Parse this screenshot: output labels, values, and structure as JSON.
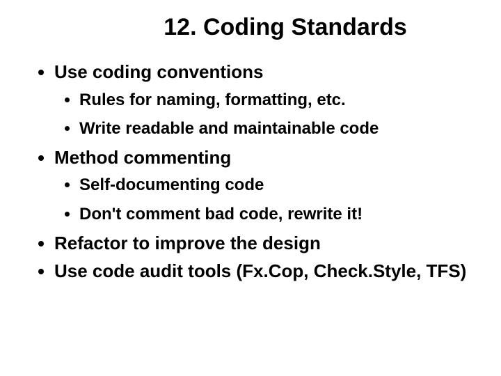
{
  "slide": {
    "title": "12. Coding Standards",
    "bullets": [
      {
        "text": "Use coding conventions",
        "children": [
          "Rules for naming, formatting, etc.",
          "Write readable and maintainable code"
        ]
      },
      {
        "text": "Method commenting",
        "children": [
          "Self-documenting code",
          "Don't comment bad code, rewrite it!"
        ]
      },
      {
        "text": "Refactor to improve the design",
        "children": []
      },
      {
        "text": "Use code audit tools (Fx.Cop, Check.Style, TFS)",
        "children": []
      }
    ]
  }
}
